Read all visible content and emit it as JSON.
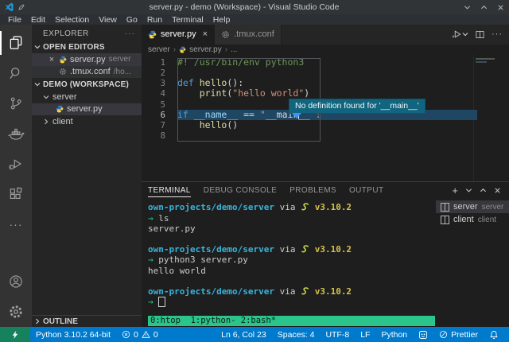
{
  "colors": {
    "accent": "#007acc",
    "remote_green": "#16825d",
    "tmux_green": "#2bc48a",
    "tooltip_bg": "#11657f",
    "line_highlight": "#1f4662"
  },
  "titlebar": {
    "title": "server.py - demo (Workspace) - Visual Studio Code",
    "controls": [
      "minimize-icon",
      "maximize-icon",
      "close-icon"
    ]
  },
  "menubar": {
    "items": [
      "File",
      "Edit",
      "Selection",
      "View",
      "Go",
      "Run",
      "Terminal",
      "Help"
    ]
  },
  "activity_bar": {
    "icons": [
      "files-icon",
      "search-icon",
      "source-control-icon",
      "docker-icon",
      "run-debug-icon",
      "extensions-icon",
      "more-icon",
      "account-icon",
      "settings-icon"
    ]
  },
  "sidebar": {
    "title": "EXPLORER",
    "sections": {
      "open_editors": {
        "label": "OPEN EDITORS",
        "items": [
          {
            "name": "server.py",
            "detail": "server",
            "icon": "python-icon",
            "active": true
          },
          {
            "name": ".tmux.conf",
            "detail": "/ho...",
            "icon": "gear-icon",
            "active": false
          }
        ]
      },
      "workspace": {
        "label": "DEMO (WORKSPACE)",
        "tree": [
          {
            "name": "server",
            "type": "folder",
            "expanded": true
          },
          {
            "name": "server.py",
            "type": "file",
            "icon": "python-icon",
            "selected": true
          },
          {
            "name": "client",
            "type": "folder",
            "expanded": false
          }
        ]
      },
      "outline": {
        "label": "OUTLINE"
      }
    }
  },
  "editor": {
    "tabs": [
      {
        "label": "server.py",
        "icon": "python-icon",
        "active": true
      },
      {
        "label": ".tmux.conf",
        "icon": "gear-icon",
        "active": false
      }
    ],
    "actions": [
      "run-icon",
      "chevron-down-icon",
      "split-editor-icon",
      "more-actions-icon"
    ],
    "breadcrumb": [
      "server",
      "server.py",
      "..."
    ],
    "tooltip": "No definition found for '__main__'",
    "code_lines": [
      {
        "num": "1",
        "tokens": [
          {
            "t": "#! /usr/bin/env python3",
            "c": "comment"
          }
        ]
      },
      {
        "num": "2",
        "tokens": []
      },
      {
        "num": "3",
        "tokens": [
          {
            "t": "def",
            "c": "keyword"
          },
          {
            "t": " ",
            "c": "plain"
          },
          {
            "t": "hello",
            "c": "function"
          },
          {
            "t": "():",
            "c": "plain"
          }
        ]
      },
      {
        "num": "4",
        "tokens": [
          {
            "t": "    ",
            "c": "plain"
          },
          {
            "t": "print",
            "c": "function"
          },
          {
            "t": "(",
            "c": "plain"
          },
          {
            "t": "\"hello world\"",
            "c": "string"
          },
          {
            "t": ")",
            "c": "plain"
          }
        ]
      },
      {
        "num": "5",
        "tokens": []
      },
      {
        "num": "6",
        "current": true,
        "tokens": [
          {
            "t": "if",
            "c": "keyword"
          },
          {
            "t": " ",
            "c": "plain"
          },
          {
            "t": "__name__",
            "c": "variable"
          },
          {
            "t": " == ",
            "c": "plain"
          },
          {
            "t": "\"",
            "c": "string"
          },
          {
            "t": "__main",
            "c": "linkword"
          },
          {
            "t": "",
            "c": "cursor"
          },
          {
            "t": "__",
            "c": "linkword"
          },
          {
            "t": "\":",
            "c": "string"
          }
        ]
      },
      {
        "num": "7",
        "tokens": [
          {
            "t": "    ",
            "c": "plain"
          },
          {
            "t": "hello",
            "c": "function"
          },
          {
            "t": "()",
            "c": "plain"
          }
        ]
      },
      {
        "num": "8",
        "tokens": []
      }
    ]
  },
  "panel": {
    "tabs": [
      {
        "label": "TERMINAL",
        "active": true
      },
      {
        "label": "DEBUG CONSOLE"
      },
      {
        "label": "PROBLEMS"
      },
      {
        "label": "OUTPUT"
      }
    ],
    "actions": [
      "new-terminal-icon",
      "chevron-down-icon",
      "chevron-up-icon",
      "close-icon"
    ],
    "terminal_lines": [
      {
        "tokens": [
          {
            "t": "own-projects/demo/server",
            "c": "cyan"
          },
          {
            "t": " via ",
            "c": "fg"
          },
          {
            "icon": "python-snake-emoji"
          },
          {
            "t": " v3.10.2",
            "c": "yellow"
          }
        ]
      },
      {
        "tokens": [
          {
            "t": "→",
            "c": "green"
          },
          {
            "t": " ls",
            "c": "fg"
          }
        ]
      },
      {
        "tokens": [
          {
            "t": "server.py",
            "c": "fg"
          }
        ]
      },
      {
        "tokens": []
      },
      {
        "tokens": [
          {
            "t": "own-projects/demo/server",
            "c": "cyan"
          },
          {
            "t": " via ",
            "c": "fg"
          },
          {
            "icon": "python-snake-emoji"
          },
          {
            "t": " v3.10.2",
            "c": "yellow"
          }
        ]
      },
      {
        "tokens": [
          {
            "t": "→",
            "c": "green"
          },
          {
            "t": " python3 server.py",
            "c": "fg"
          }
        ]
      },
      {
        "tokens": [
          {
            "t": "hello world",
            "c": "fg"
          }
        ]
      },
      {
        "tokens": []
      },
      {
        "tokens": [
          {
            "t": "own-projects/demo/server",
            "c": "cyan"
          },
          {
            "t": " via ",
            "c": "fg"
          },
          {
            "icon": "python-snake-emoji"
          },
          {
            "t": " v3.10.2",
            "c": "yellow"
          }
        ]
      },
      {
        "tokens": [
          {
            "t": "→ ",
            "c": "green"
          },
          {
            "t": "",
            "c": "block-cursor"
          }
        ]
      }
    ],
    "tmux_status": "0:htop  1:python- 2:bash*",
    "terminal_list": [
      {
        "name": "server",
        "detail": "server",
        "selected": true
      },
      {
        "name": "client",
        "detail": "client",
        "selected": false
      }
    ]
  },
  "status_bar": {
    "remote_icon": "remote-icon",
    "left": {
      "interpreter": "Python 3.10.2 64-bit",
      "errors": "0",
      "warnings": "0"
    },
    "right": {
      "cursor_position": "Ln 6, Col 23",
      "indentation": "Spaces: 4",
      "encoding": "UTF-8",
      "eol": "LF",
      "language": "Python",
      "formatter": "Prettier"
    }
  }
}
